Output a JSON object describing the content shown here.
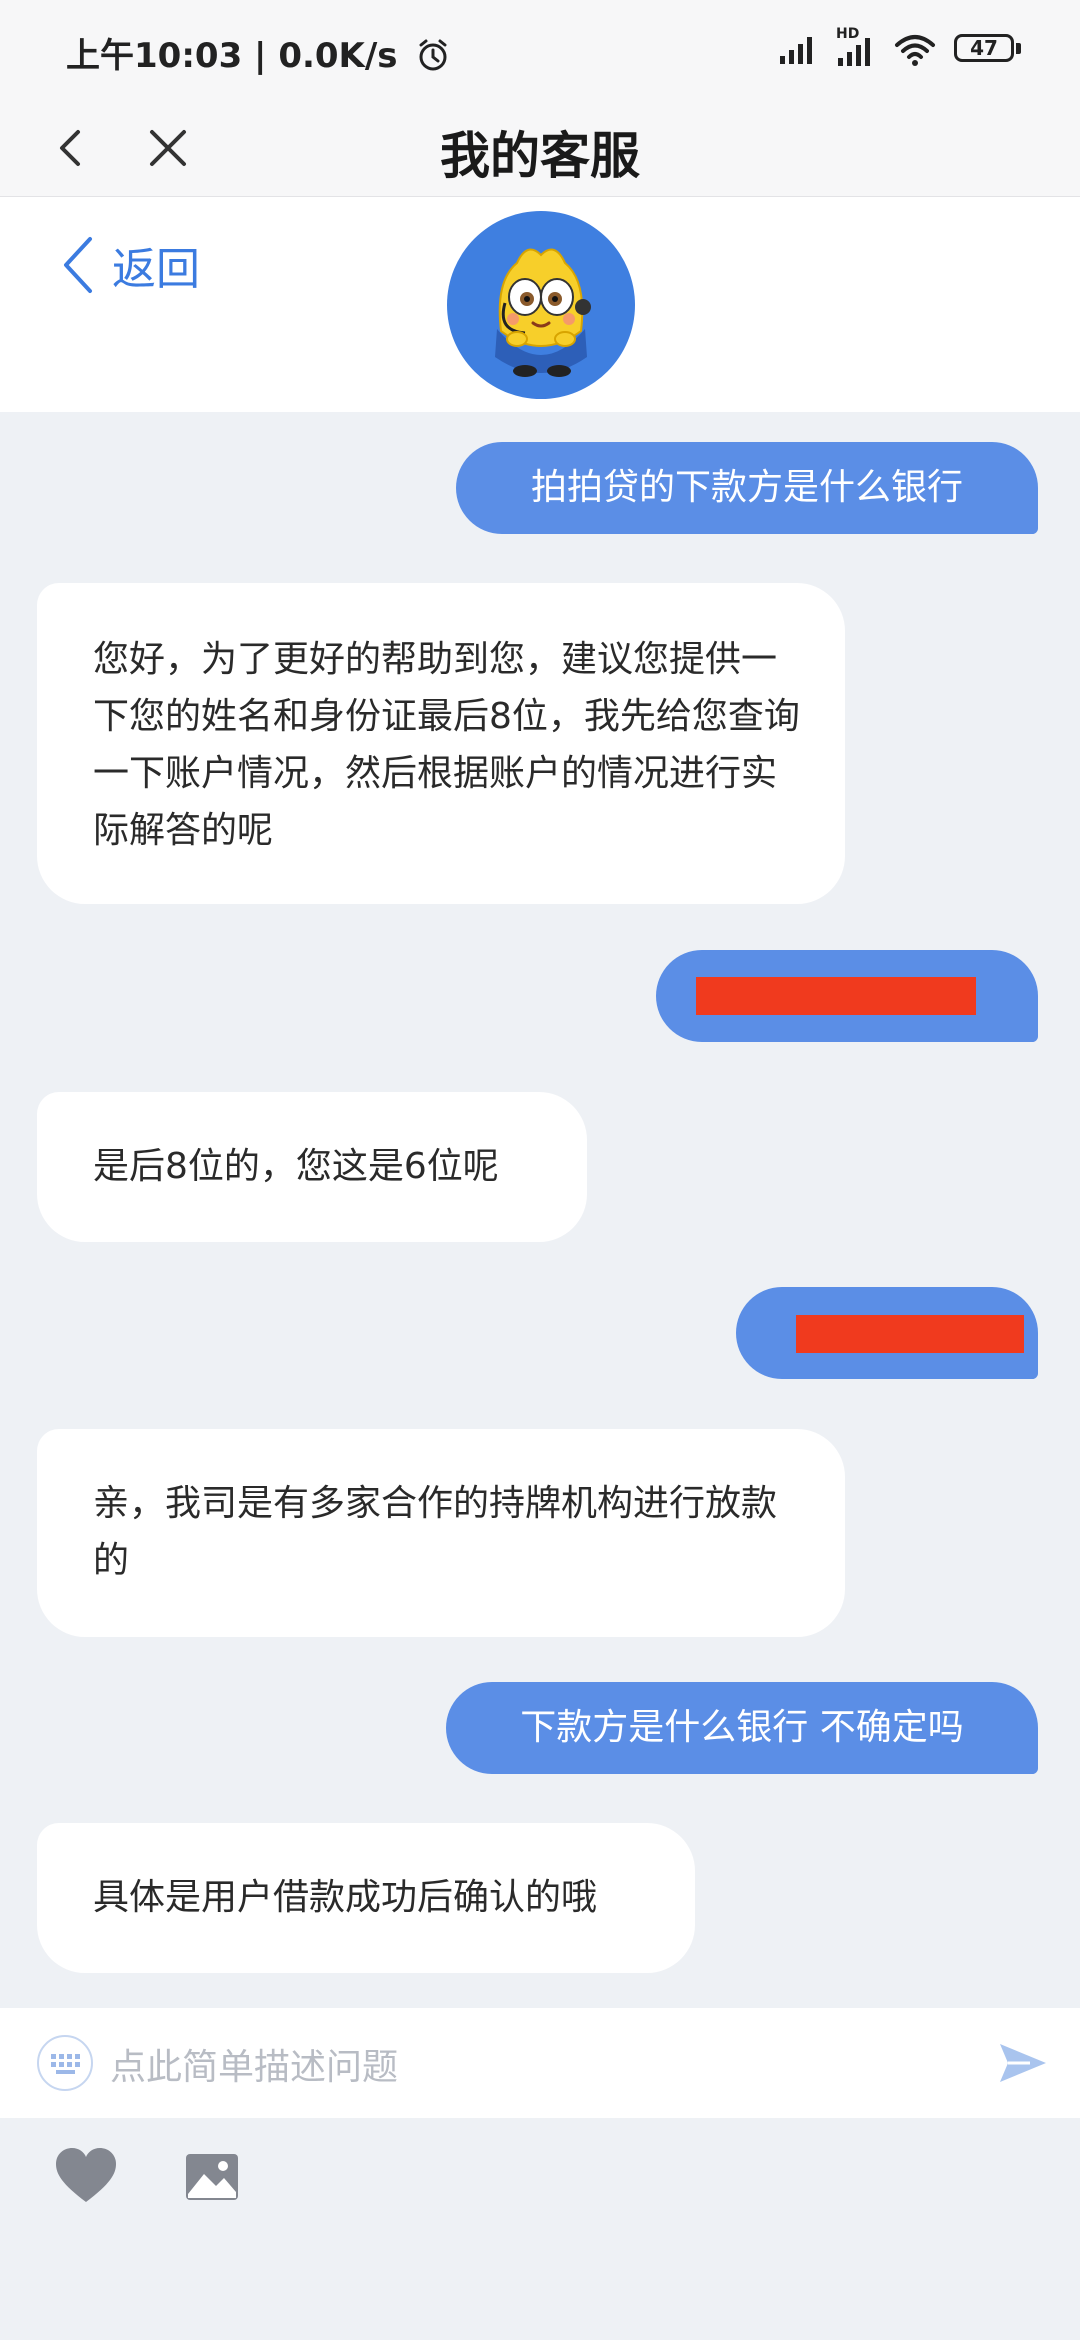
{
  "status_bar": {
    "time_speed": "上午10:03 | 0.0K/s",
    "hd_label": "HD",
    "battery": "47"
  },
  "nav": {
    "title": "我的客服"
  },
  "header": {
    "back_label": "返回"
  },
  "messages": [
    {
      "sender": "user",
      "text": "拍拍贷的下款方是什么银行"
    },
    {
      "sender": "agent",
      "text": "您好，为了更好的帮助到您，建议您提供一下您的姓名和身份证最后8位，我先给您查询一下账户情况，然后根据账户的情况进行实际解答的呢"
    },
    {
      "sender": "user",
      "text": "",
      "redacted": true
    },
    {
      "sender": "agent",
      "text": "是后8位的，您这是6位呢"
    },
    {
      "sender": "user",
      "text": "",
      "redacted": true
    },
    {
      "sender": "agent",
      "text": "亲，我司是有多家合作的持牌机构进行放款的"
    },
    {
      "sender": "user",
      "text": "下款方是什么银行 不确定吗"
    },
    {
      "sender": "agent",
      "text": "具体是用户借款成功后确认的哦"
    }
  ],
  "input": {
    "placeholder": "点此简单描述问题"
  },
  "colors": {
    "user_bubble": "#5b8ee6",
    "agent_bubble": "#ffffff",
    "accent": "#3b7be0",
    "redaction": "#f03a1e"
  },
  "icons": [
    "back-chevron-icon",
    "close-icon",
    "clock-icon",
    "signal-icon",
    "wifi-icon",
    "battery-icon",
    "mascot-avatar",
    "keyboard-icon",
    "send-icon",
    "heart-icon",
    "image-icon"
  ]
}
